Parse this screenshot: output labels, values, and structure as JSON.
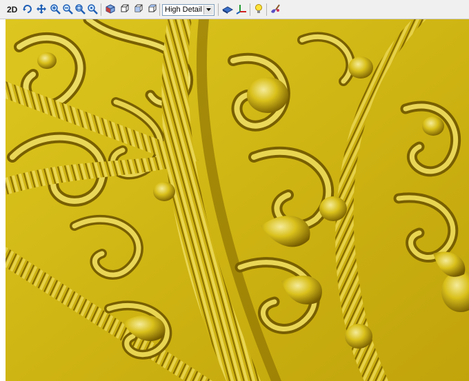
{
  "toolbar": {
    "view_mode_label": "2D",
    "buttons": [
      {
        "name": "rotate-view-icon"
      },
      {
        "name": "pan-view-icon"
      },
      {
        "name": "zoom-in-icon"
      },
      {
        "name": "zoom-out-icon"
      },
      {
        "name": "zoom-window-icon"
      },
      {
        "name": "zoom-extents-icon"
      },
      {
        "name": "iso-view-icon"
      },
      {
        "name": "front-view-icon"
      },
      {
        "name": "side-view-icon"
      },
      {
        "name": "top-view-icon"
      },
      {
        "name": "render-mode-icon"
      },
      {
        "name": "axis-icon"
      },
      {
        "name": "light-bulb-icon"
      },
      {
        "name": "material-brush-icon"
      }
    ],
    "detail_select": {
      "value": "High Detail"
    }
  },
  "viewport": {
    "content": "3d-relief-model",
    "colors": {
      "relief_base": "#d9bf16",
      "relief_highlight": "#fff27a",
      "relief_shadow": "#8a6e00"
    }
  }
}
